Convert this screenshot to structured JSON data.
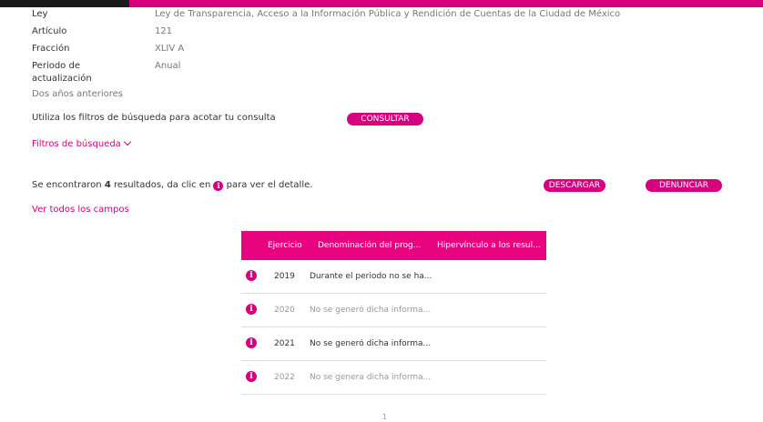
{
  "header": {
    "ley_label": "Ley",
    "ley_value": "Ley de Transparencia, Acceso a la Información Pública y Rendición de Cuentas de la Ciudad de México",
    "articulo_label": "Artículo",
    "articulo_value": "121",
    "fraccion_label": "Fracción",
    "fraccion_value": "XLIV A",
    "periodo_label_1": "Periodo de",
    "periodo_label_2": "actualización",
    "periodo_value": "Anual",
    "vigencia": "Dos años anteriores"
  },
  "filters": {
    "instruction": "Utiliza los filtros de búsqueda para acotar tu consulta",
    "consultar_label": "CONSULTAR",
    "toggle_label": "Filtros de búsqueda"
  },
  "results": {
    "prefix": "Se encontraron ",
    "count": "4",
    "middle": " resultados, da clic en ",
    "suffix": " para ver el detalle.",
    "descargar_label": "DESCARGAR",
    "denunciar_label": "DENUNCIAR",
    "ver_todos_label": "Ver todos los campos"
  },
  "table": {
    "columns": [
      "Ejercicio",
      "Denominación del prog...",
      "Hipervínculo a los resul..."
    ],
    "rows": [
      {
        "ejercicio": "2019",
        "denominacion": "Durante el periodo no se ha..."
      },
      {
        "ejercicio": "2020",
        "denominacion": "No se generó dicha informa..."
      },
      {
        "ejercicio": "2021",
        "denominacion": "No se generó dicha informa..."
      },
      {
        "ejercicio": "2022",
        "denominacion": "No se genera dicha informa..."
      }
    ]
  },
  "pagination": {
    "current": "1"
  },
  "colors": {
    "accent": "#d6007e",
    "header_bg": "#e8047f",
    "topbar_dark": "#1a1a1a"
  },
  "icons": {
    "info": "info-circle-icon",
    "chevron": "chevron-down-icon"
  }
}
